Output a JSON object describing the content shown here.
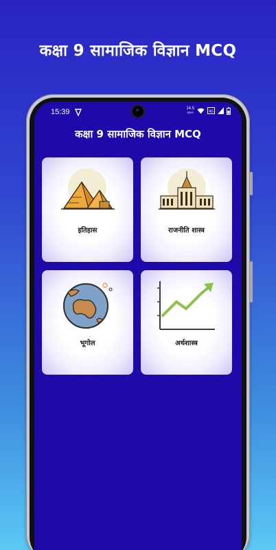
{
  "promo": {
    "title": "कक्षा 9 सामाजिक विज्ञान MCQ"
  },
  "status_bar": {
    "time": "15:39",
    "net_speed_value": "14.5",
    "net_speed_unit": "KB/S"
  },
  "app_bar": {
    "title": "कक्षा 9 सामाजिक विज्ञान MCQ"
  },
  "categories": [
    {
      "label": "इतिहास",
      "icon": "pyramids-icon"
    },
    {
      "label": "राजनीति शास्त्र",
      "icon": "parliament-icon"
    },
    {
      "label": "भूगोल",
      "icon": "globe-icon"
    },
    {
      "label": "अर्थशास्त्र",
      "icon": "growth-chart-icon"
    }
  ],
  "colors": {
    "screen_background": "#1d0aa8",
    "card_background": "#ffffff",
    "accent_green": "#8bc34a"
  }
}
